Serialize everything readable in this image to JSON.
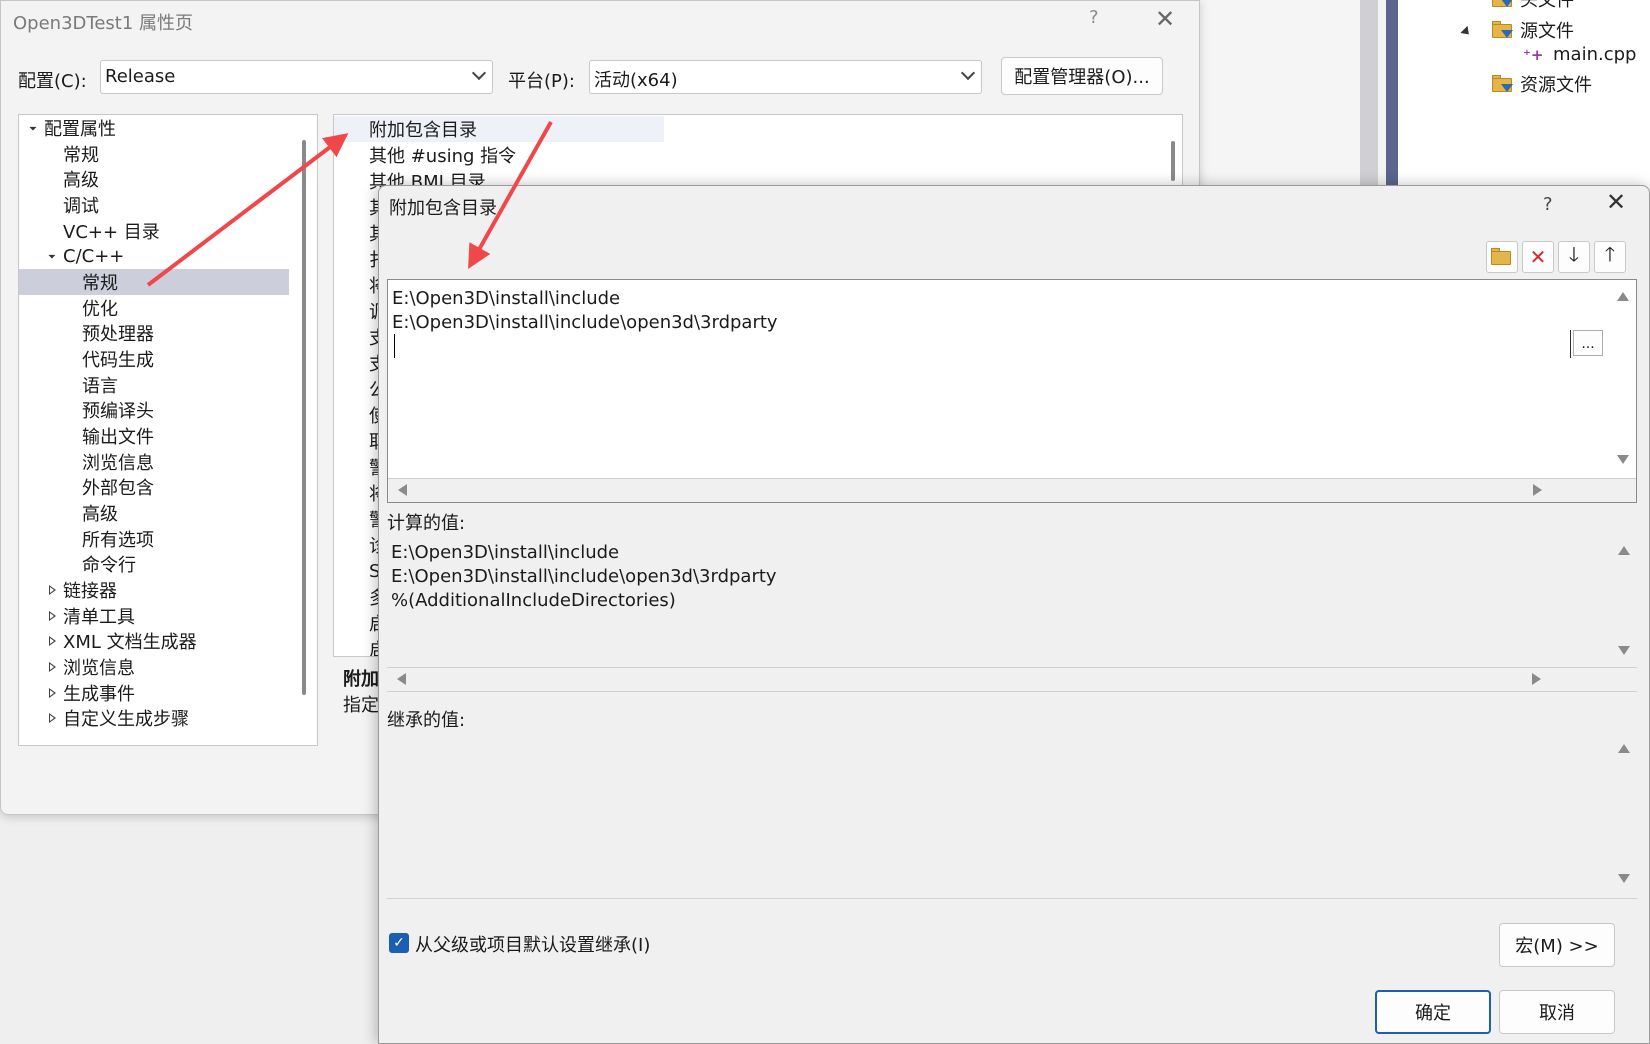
{
  "solution_explorer": {
    "items": [
      {
        "label": "头文件",
        "icon": "filter-folder-icon"
      },
      {
        "label": "源文件",
        "icon": "filter-folder-icon"
      },
      {
        "label": "main.cpp",
        "icon": "cpp-file-icon"
      },
      {
        "label": "资源文件",
        "icon": "filter-folder-icon"
      }
    ]
  },
  "main_window": {
    "title": "Open3DTest1 属性页",
    "help": "?",
    "close": "✕",
    "config_label": "配置(C):",
    "config_value": "Release",
    "platform_label": "平台(P):",
    "platform_value": "活动(x64)",
    "config_manager_label": "配置管理器(O)...",
    "tree": {
      "items": [
        {
          "label": "配置属性",
          "level": 0,
          "expander": "expanded"
        },
        {
          "label": "常规",
          "level": 1
        },
        {
          "label": "高级",
          "level": 1
        },
        {
          "label": "调试",
          "level": 1
        },
        {
          "label": "VC++ 目录",
          "level": 1
        },
        {
          "label": "C/C++",
          "level": 1,
          "expander": "expanded"
        },
        {
          "label": "常规",
          "level": 2,
          "selected": true
        },
        {
          "label": "优化",
          "level": 2
        },
        {
          "label": "预处理器",
          "level": 2
        },
        {
          "label": "代码生成",
          "level": 2
        },
        {
          "label": "语言",
          "level": 2
        },
        {
          "label": "预编译头",
          "level": 2
        },
        {
          "label": "输出文件",
          "level": 2
        },
        {
          "label": "浏览信息",
          "level": 2
        },
        {
          "label": "外部包含",
          "level": 2
        },
        {
          "label": "高级",
          "level": 2
        },
        {
          "label": "所有选项",
          "level": 2
        },
        {
          "label": "命令行",
          "level": 2
        },
        {
          "label": "链接器",
          "level": 1,
          "expander": "collapsed"
        },
        {
          "label": "清单工具",
          "level": 1,
          "expander": "collapsed"
        },
        {
          "label": "XML 文档生成器",
          "level": 1,
          "expander": "collapsed"
        },
        {
          "label": "浏览信息",
          "level": 1,
          "expander": "collapsed"
        },
        {
          "label": "生成事件",
          "level": 1,
          "expander": "collapsed"
        },
        {
          "label": "自定义生成步骤",
          "level": 1,
          "expander": "collapsed"
        }
      ]
    },
    "grid": {
      "rows": [
        "附加包含目录",
        "其他 #using 指令",
        "其他 BMI 目录",
        "其",
        "其",
        "扌",
        "将",
        "调",
        "支",
        "支",
        "公",
        "使",
        "取",
        "警",
        "将",
        "警",
        "诊",
        "S",
        "多",
        "启",
        "启"
      ]
    },
    "description": {
      "title": "附加",
      "text": "指定"
    }
  },
  "dialog": {
    "title": "附加包含目录",
    "help": "?",
    "close": "✕",
    "toolbar": {
      "new_line": "new-line-icon",
      "delete": "delete-icon",
      "move_down": "move-down-icon",
      "move_up": "move-up-icon"
    },
    "edit_lines": [
      "E:\\Open3D\\install\\include",
      "E:\\Open3D\\install\\include\\open3d\\3rdparty"
    ],
    "browse_label": "...",
    "evaluated_label": "计算的值:",
    "evaluated_lines": [
      "E:\\Open3D\\install\\include",
      "E:\\Open3D\\install\\include\\open3d\\3rdparty",
      "%(AdditionalIncludeDirectories)"
    ],
    "inherited_label": "继承的值:",
    "inherit_checkbox_label": "从父级或项目默认设置继承(I)",
    "inherit_checked": true,
    "macros_button": "宏(M) >>",
    "ok_button": "确定",
    "cancel_button": "取消"
  },
  "colors": {
    "annotation_arrow": "#f0484a",
    "selection": "#cccedb",
    "accent": "#1a5fb4"
  }
}
